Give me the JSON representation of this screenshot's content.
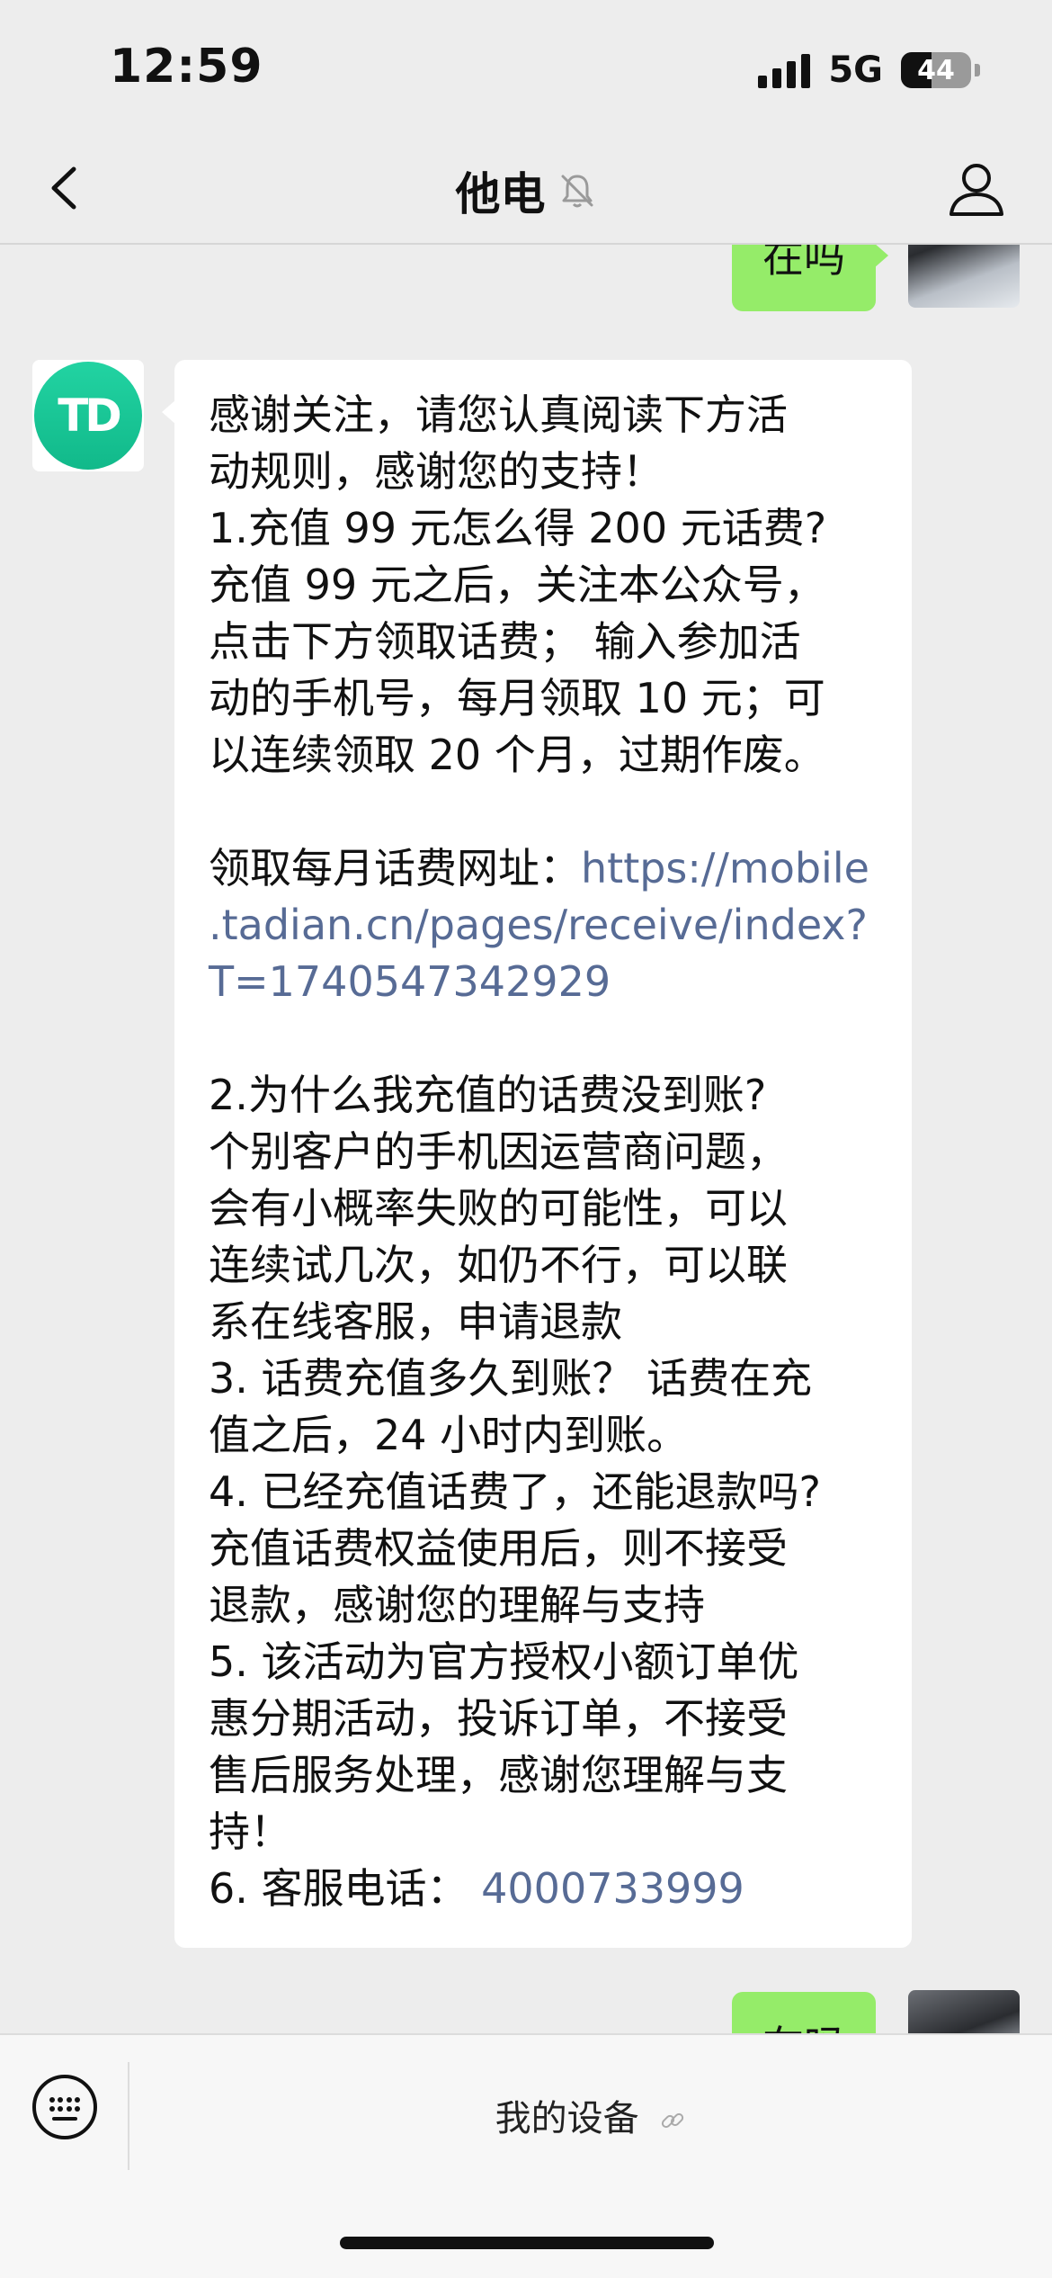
{
  "status_bar": {
    "time": "12:59",
    "network": "5G",
    "battery": "44",
    "battery_level": 0.44
  },
  "nav": {
    "title": "他电",
    "back_icon": "chevron-left-icon",
    "mute_icon": "bell-slash-icon",
    "profile_icon": "person-icon"
  },
  "messages": {
    "me_1": "在吗",
    "me_2": "在吗",
    "bot_avatar_text": "TD",
    "bot_lines": [
      "感谢关注，请您认真阅读下方活",
      "动规则，感谢您的支持！",
      "1.充值 99 元怎么得 200 元话费?",
      "充值 99 元之后，关注本公众号，",
      "点击下方领取话费； 输入参加活",
      "动的手机号，每月领取 10 元；可",
      "以连续领取 20 个月，过期作废。",
      "",
      "领取每月话费网址：",
      "https://mobile",
      ".tadian.cn/pages/receive/index?",
      "T=1740547342929",
      "",
      "2.为什么我充值的话费没到账?",
      "个别客户的手机因运营商问题，",
      "会有小概率失败的可能性，可以",
      "连续试几次，如仍不行，可以联",
      "系在线客服，申请退款",
      "3. 话费充值多久到账？ 话费在充",
      "值之后，24 小时内到账。",
      "4. 已经充值话费了，还能退款吗?",
      "充值话费权益使用后，则不接受",
      "退款，感谢您的理解与支持",
      "5. 该活动为官方授权小额订单优",
      "惠分期活动，投诉订单，不接受",
      "售后服务处理，感谢您理解与支",
      "持！",
      "6. 客服电话：  ",
      "4000733999"
    ]
  },
  "bottom": {
    "keyboard_icon": "keyboard-icon",
    "menu_label": "我的设备",
    "link_icon": "link-icon"
  },
  "colors": {
    "background": "#ededed",
    "my_bubble": "#95ec69",
    "link": "#576b95",
    "brand_green": "#1bc796"
  }
}
